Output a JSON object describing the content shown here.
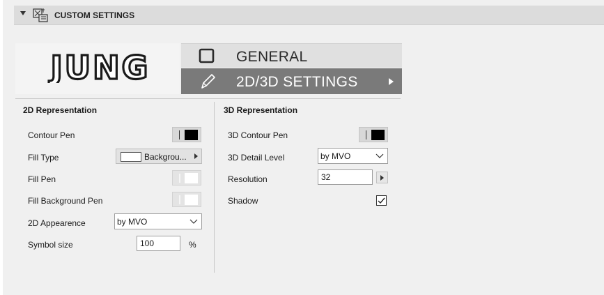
{
  "header": {
    "title": "CUSTOM SETTINGS"
  },
  "logo": {
    "text": "JUNG"
  },
  "tabs": [
    {
      "label": "GENERAL",
      "active": false
    },
    {
      "label": "2D/3D SETTINGS",
      "active": true
    }
  ],
  "rep2d": {
    "title": "2D Representation",
    "contour_pen_label": "Contour Pen",
    "fill_type_label": "Fill Type",
    "fill_type_value": "Backgrou...",
    "fill_pen_label": "Fill Pen",
    "fill_bg_pen_label": "Fill Background Pen",
    "appearance_label": "2D Appearence",
    "appearance_value": "by MVO",
    "symbol_size_label": "Symbol size",
    "symbol_size_value": "100",
    "symbol_size_unit": "%"
  },
  "rep3d": {
    "title": "3D Representation",
    "contour_pen_label": "3D Contour Pen",
    "detail_level_label": "3D Detail Level",
    "detail_level_value": "by MVO",
    "resolution_label": "Resolution",
    "resolution_value": "32",
    "shadow_label": "Shadow",
    "shadow_checked": true
  },
  "colors": {
    "active_tab": "#7a7a7a",
    "header": "#dcdcdc",
    "panel": "#f0f0f0"
  }
}
